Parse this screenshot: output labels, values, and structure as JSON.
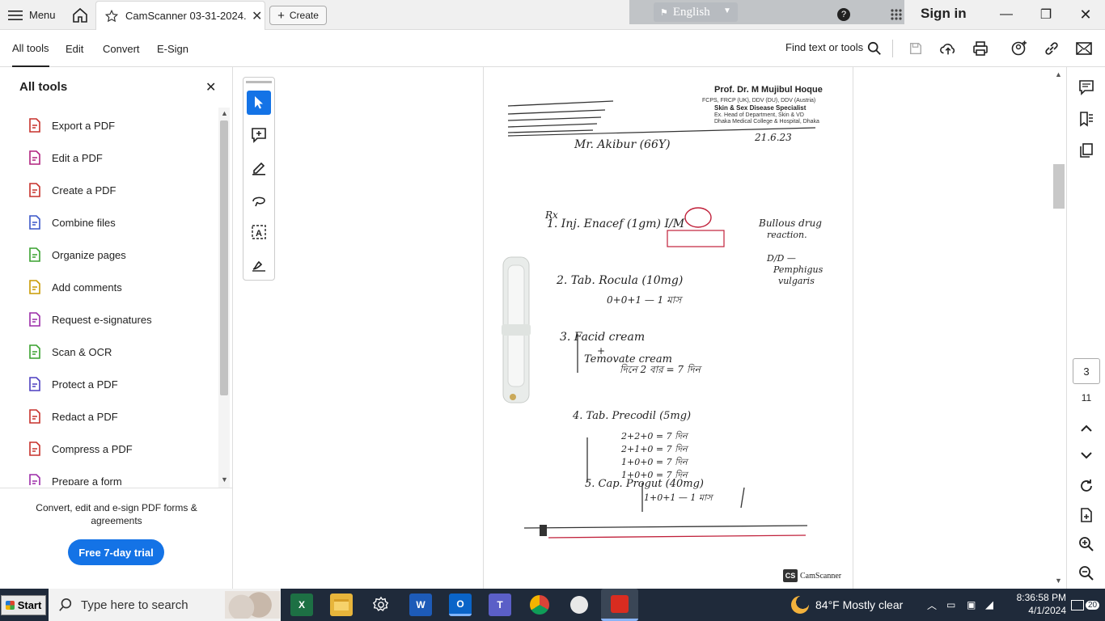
{
  "titlebar": {
    "menu_label": "Menu",
    "tab_title": "CamScanner 03-31-2024...",
    "create_label": "Create",
    "language": "English",
    "signin_label": "Sign in"
  },
  "toolbar": {
    "tabs": [
      {
        "label": "All tools"
      },
      {
        "label": "Edit"
      },
      {
        "label": "Convert"
      },
      {
        "label": "E-Sign"
      }
    ],
    "find_label": "Find text or tools"
  },
  "left_panel": {
    "title": "All tools",
    "tools": [
      {
        "label": "Export a PDF",
        "icon": "export-pdf-icon"
      },
      {
        "label": "Edit a PDF",
        "icon": "edit-pdf-icon"
      },
      {
        "label": "Create a PDF",
        "icon": "create-pdf-icon"
      },
      {
        "label": "Combine files",
        "icon": "combine-files-icon"
      },
      {
        "label": "Organize pages",
        "icon": "organize-pages-icon"
      },
      {
        "label": "Add comments",
        "icon": "add-comments-icon"
      },
      {
        "label": "Request e-signatures",
        "icon": "request-esign-icon"
      },
      {
        "label": "Scan & OCR",
        "icon": "scan-ocr-icon"
      },
      {
        "label": "Protect a PDF",
        "icon": "protect-pdf-icon"
      },
      {
        "label": "Redact a PDF",
        "icon": "redact-pdf-icon"
      },
      {
        "label": "Compress a PDF",
        "icon": "compress-pdf-icon"
      },
      {
        "label": "Prepare a form",
        "icon": "prepare-form-icon"
      }
    ],
    "promo_text": "Convert, edit and e-sign PDF forms & agreements",
    "trial_button": "Free 7-day trial"
  },
  "document": {
    "doctor_name": "Prof. Dr. M Mujibul Hoque",
    "doctor_quals": "FCPS, FRCP (UK), DDV (DU), DDV (Austria)",
    "doctor_specialty": "Skin & Sex Disease Specialist",
    "doctor_position": "Ex. Head of Department, Skin & VD",
    "doctor_hospital": "Dhaka Medical College & Hospital, Dhaka",
    "patient_line": "Mr. Akibur (66Y)",
    "date_line": "21.6.23",
    "rx_lines": [
      "Rx",
      "1. Inj. Enacef (1gm) I/M",
      "2. Tab. Rocula (10mg)",
      "0+0+1 — 1 মাস",
      "3. Facid cream",
      "+",
      "Temovate cream",
      "দিনে 2 বার = 7 দিন",
      "4. Tab. Precodil (5mg)",
      "2+2+0 = 7 দিন",
      "2+1+0 = 7 দিন",
      "1+0+0 = 7 দিন",
      "1+0+0 = 7 দিন",
      "5. Cap. Progut (40mg)",
      "1+0+1 — 1 মাস"
    ],
    "side_note": [
      "Bullous drug",
      "reaction.",
      "D/D —",
      "Pemphigus",
      "vulgaris"
    ],
    "watermark": "CamScanner"
  },
  "right_rail": {
    "current_page": "3",
    "total_pages": "11"
  },
  "taskbar": {
    "start_label": "Start",
    "search_placeholder": "Type here to search",
    "weather": "84°F  Mostly clear",
    "time": "8:36:58 PM",
    "date": "4/1/2024",
    "notification_count": "20"
  }
}
